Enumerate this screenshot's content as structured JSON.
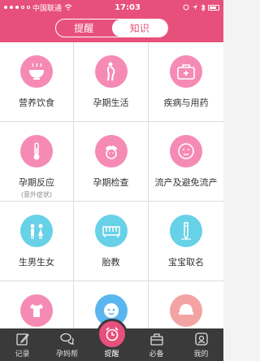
{
  "status_bar": {
    "carrier": "中国联通",
    "time": "17:03"
  },
  "segment": {
    "tabs": [
      "提醒",
      "知识"
    ],
    "active": "知识"
  },
  "grid": [
    {
      "label": "营养饮食",
      "sub": "",
      "icon": "bowl-icon",
      "color": "pink"
    },
    {
      "label": "孕期生活",
      "sub": "",
      "icon": "pregnant-woman-icon",
      "color": "pink"
    },
    {
      "label": "疾病与用药",
      "sub": "",
      "icon": "medical-kit-icon",
      "color": "pink"
    },
    {
      "label": "孕期反应",
      "sub": "(意外症状)",
      "icon": "thermometer-icon",
      "color": "pink"
    },
    {
      "label": "孕期检查",
      "sub": "",
      "icon": "nurse-icon",
      "color": "pink"
    },
    {
      "label": "流产及避免流产",
      "sub": "",
      "icon": "sad-face-icon",
      "color": "pink"
    },
    {
      "label": "生男生女",
      "sub": "",
      "icon": "boy-girl-icon",
      "color": "cyan"
    },
    {
      "label": "胎教",
      "sub": "",
      "icon": "piano-icon",
      "color": "cyan"
    },
    {
      "label": "宝宝取名",
      "sub": "",
      "icon": "pen-icon",
      "color": "cyan"
    },
    {
      "label": "",
      "sub": "",
      "icon": "baby-clothes-icon",
      "color": "pink"
    },
    {
      "label": "",
      "sub": "",
      "icon": "baby-face-icon",
      "color": "blue"
    },
    {
      "label": "",
      "sub": "",
      "icon": "baby-hat-icon",
      "color": "peach"
    }
  ],
  "tabbar": [
    {
      "label": "记录",
      "icon": "edit-icon"
    },
    {
      "label": "孕妈帮",
      "icon": "chat-bubbles-icon"
    },
    {
      "label": "提醒",
      "icon": "alarm-clock-icon"
    },
    {
      "label": "必备",
      "icon": "briefcase-icon"
    },
    {
      "label": "我的",
      "icon": "profile-icon"
    }
  ],
  "colors": {
    "primary": "#e8507c",
    "pink": "#f58bb4",
    "cyan": "#67d1e7",
    "blue": "#5ab6ef",
    "peach": "#f4a3a3",
    "tabbar_bg": "#3a3a3a"
  }
}
